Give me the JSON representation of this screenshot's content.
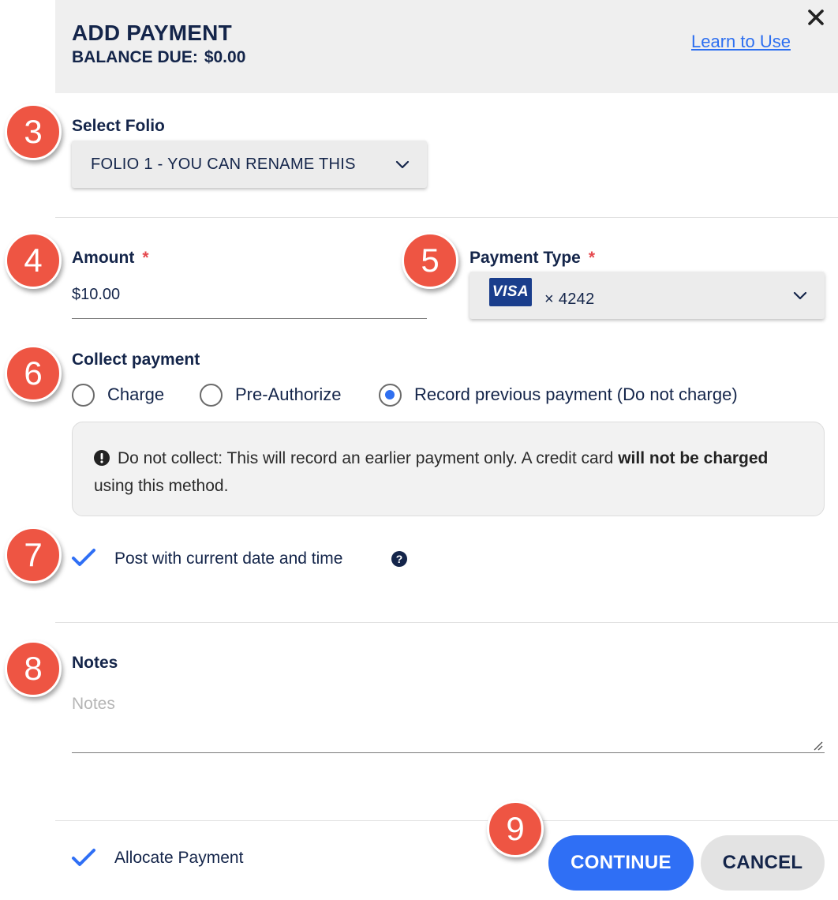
{
  "header": {
    "title": "ADD PAYMENT",
    "balance_label": "BALANCE DUE:",
    "balance_value": "$0.00",
    "learn_link": "Learn to Use"
  },
  "folio": {
    "label": "Select Folio",
    "selected": "FOLIO 1 - YOU CAN RENAME THIS"
  },
  "amount": {
    "label": "Amount",
    "required_mark": "*",
    "value": "$10.00"
  },
  "payment_type": {
    "label": "Payment Type",
    "required_mark": "*",
    "card_brand": "VISA",
    "card_last4": "× 4242"
  },
  "collect": {
    "label": "Collect payment",
    "options": [
      {
        "label": "Charge",
        "selected": false
      },
      {
        "label": "Pre-Authorize",
        "selected": false
      },
      {
        "label": "Record previous payment (Do not charge)",
        "selected": true
      }
    ],
    "info_prefix": "Do not collect: This will record an earlier payment only. A credit card ",
    "info_bold": "will not be charged",
    "info_suffix": " using this method."
  },
  "post_date": {
    "label": "Post with current date and time",
    "checked": true
  },
  "notes": {
    "label": "Notes",
    "placeholder": "Notes"
  },
  "footer": {
    "allocate_label": "Allocate Payment",
    "allocate_checked": true,
    "continue_label": "CONTINUE",
    "cancel_label": "CANCEL"
  },
  "callouts": [
    "3",
    "4",
    "5",
    "6",
    "7",
    "8",
    "9"
  ],
  "colors": {
    "accent": "#2f6ff5",
    "callout": "#ee5543",
    "required": "#e5484d",
    "header_bg": "#efefef"
  }
}
